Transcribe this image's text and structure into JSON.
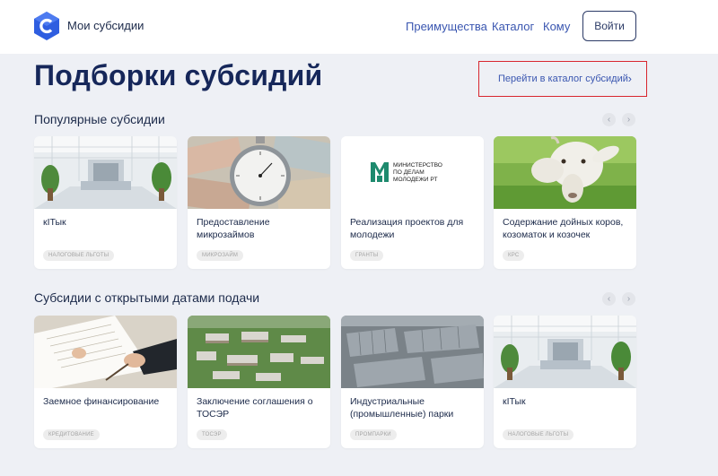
{
  "header": {
    "brand": "Мои субсидии",
    "nav": [
      "Преимущества",
      "Каталог",
      "Кому"
    ],
    "login_label": "Войти"
  },
  "page": {
    "title": "Подборки субсидий",
    "catalog_link": "Перейти в каталог субсидий"
  },
  "sections": [
    {
      "title": "Популярные субсидии",
      "cards": [
        {
          "title": "кIТык",
          "tag": "НАЛОГОВЫЕ ЛЬГОТЫ"
        },
        {
          "title": "Предоставление микрозаймов",
          "tag": "МИКРОЗАЙМ"
        },
        {
          "title": "Реализация проектов для молодежи",
          "tag": "ГРАНТЫ"
        },
        {
          "title": "Содержание дойных коров, козоматок и козочек",
          "tag": "КРС"
        }
      ]
    },
    {
      "title": "Субсидии с открытыми датами подачи",
      "cards": [
        {
          "title": "Заемное финансирование",
          "tag": "КРЕДИТОВАНИЕ"
        },
        {
          "title": "Заключение соглашения о ТОСЭР",
          "tag": "ТОСЭР"
        },
        {
          "title": "Индустриальные (промышленные) парки",
          "tag": "ПРОМПАРКИ"
        },
        {
          "title": "кIТык",
          "tag": "НАЛОГОВЫЕ ЛЬГОТЫ"
        }
      ]
    }
  ],
  "ministry_logo_text": [
    "МИНИСТЕРСТВО",
    "ПО ДЕЛАМ",
    "МОЛОДЕЖИ РТ"
  ],
  "colors": {
    "accent": "#3a56b0",
    "title": "#16275a",
    "highlight_border": "#d8262e",
    "ministry_green": "#1e8a6e"
  }
}
